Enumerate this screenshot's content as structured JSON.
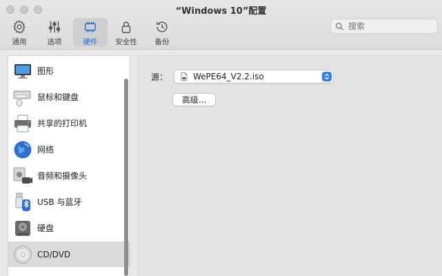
{
  "window": {
    "title": "“Windows 10”配置"
  },
  "toolbar": {
    "items": [
      {
        "label": "通用",
        "icon": "gear-icon"
      },
      {
        "label": "选项",
        "icon": "sliders-icon"
      },
      {
        "label": "硬件",
        "icon": "chip-icon",
        "active": true
      },
      {
        "label": "安全性",
        "icon": "lock-icon"
      },
      {
        "label": "备份",
        "icon": "history-icon"
      }
    ],
    "search_placeholder": "搜索"
  },
  "sidebar": {
    "items": [
      {
        "label": "图形",
        "icon": "display-icon"
      },
      {
        "label": "鼠标和键盘",
        "icon": "keyboard-mouse-icon"
      },
      {
        "label": "共享的打印机",
        "icon": "printer-icon"
      },
      {
        "label": "网络",
        "icon": "globe-icon"
      },
      {
        "label": "音频和摄像头",
        "icon": "speaker-camera-icon"
      },
      {
        "label": "USB 与蓝牙",
        "icon": "usb-bluetooth-icon"
      },
      {
        "label": "硬盘",
        "icon": "hard-disk-icon"
      },
      {
        "label": "CD/DVD",
        "icon": "disc-icon",
        "selected": true
      }
    ]
  },
  "main": {
    "source_label": "源：",
    "source_value": "WePE64_V2.2.iso",
    "advanced_button": "高级..."
  },
  "colors": {
    "accent": "#2f7cf6",
    "active_label": "#1f6fd6"
  }
}
